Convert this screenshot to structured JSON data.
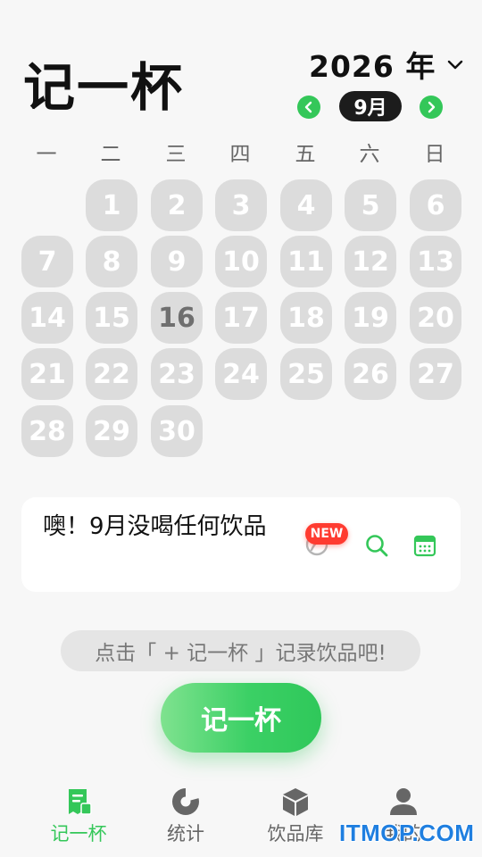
{
  "header": {
    "app_title": "记一杯",
    "year_label": "2026 年",
    "month_label": "9月",
    "weekdays": [
      "一",
      "二",
      "三",
      "四",
      "五",
      "六",
      "日"
    ]
  },
  "calendar": {
    "days": [
      "1",
      "2",
      "3",
      "4",
      "5",
      "6",
      "7",
      "8",
      "9",
      "10",
      "11",
      "12",
      "13",
      "14",
      "15",
      "16",
      "17",
      "18",
      "19",
      "20",
      "21",
      "22",
      "23",
      "24",
      "25",
      "26",
      "27",
      "28",
      "29",
      "30"
    ],
    "today": "16"
  },
  "notice": {
    "text": "噢！9月没喝任何饮品",
    "new_badge": "NEW"
  },
  "hint": "点击「 + 记一杯 」记录饮品吧!",
  "record_button_label": "记一杯",
  "tabs": [
    {
      "label": "记一杯",
      "icon": "cup-record-icon",
      "active": true
    },
    {
      "label": "统计",
      "icon": "pie-chart-icon",
      "active": false
    },
    {
      "label": "饮品库",
      "icon": "box-icon",
      "active": false
    },
    {
      "label": "我的",
      "icon": "person-icon",
      "active": false
    }
  ],
  "watermark": "ITMOP.COM",
  "colors": {
    "accent_green": "#34c759",
    "day_bg": "#dcdcdc",
    "badge_red": "#ff3b30",
    "watermark_blue": "#1f7fe0"
  }
}
